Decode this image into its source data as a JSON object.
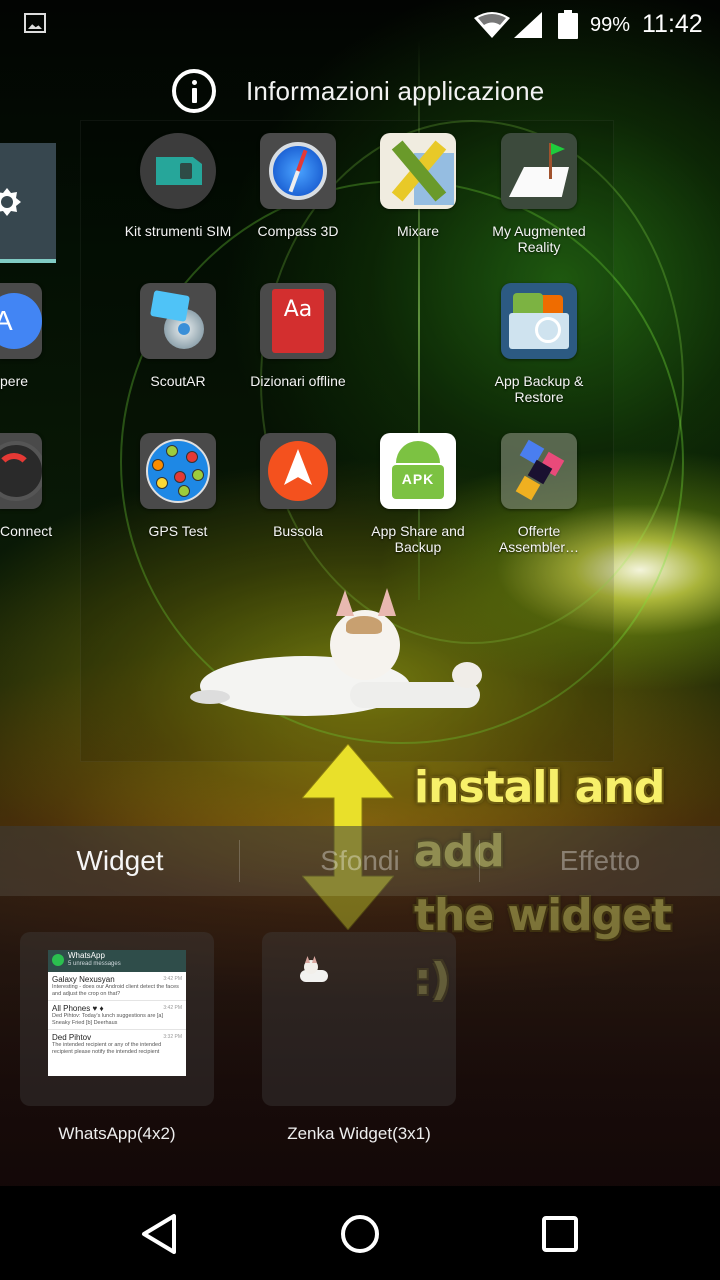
{
  "status_bar": {
    "notification_icon": "image-icon",
    "wifi_icon": "wifi-icon",
    "signal_icon": "cell-signal-icon",
    "battery_icon": "battery-icon",
    "battery_percent": "99%",
    "time": "11:42"
  },
  "drop_target": {
    "icon": "info-icon",
    "label": "Informazioni applicazione"
  },
  "apps": [
    {
      "label": "Kit strumenti SIM",
      "icon": "sim-card-icon"
    },
    {
      "label": "Compass 3D",
      "icon": "compass-icon"
    },
    {
      "label": "Mixare",
      "icon": "mixare-icon"
    },
    {
      "label": "My Augmented Reality",
      "icon": "ar-board-flag-icon"
    },
    {
      "label": "ScoutAR",
      "icon": "scoutar-icon"
    },
    {
      "label": "Dizionari offline",
      "icon": "dictionary-icon",
      "icon_text": "Aa"
    },
    {
      "label": "App Backup & Restore",
      "icon": "app-backup-icon"
    },
    {
      "label": "GPS Test",
      "icon": "gps-radar-icon"
    },
    {
      "label": "Bussola",
      "icon": "compass-arrow-icon"
    },
    {
      "label": "App Share and Backup",
      "icon": "apk-android-icon",
      "icon_text": "APK"
    },
    {
      "label": "Offerte Assembler…",
      "icon": "offerte-assembler-icon"
    }
  ],
  "left_page_apps": [
    {
      "label": "pere",
      "icon": "blue-a-icon",
      "icon_text": "A"
    },
    {
      "label": "Connect",
      "icon": "wifi-connect-icon"
    }
  ],
  "annotation": {
    "line1": "install and add",
    "line2": "the widget :)"
  },
  "picker": {
    "tabs": [
      {
        "label": "Widget",
        "active": true
      },
      {
        "label": "Sfondi",
        "active": false
      },
      {
        "label": "Effetto",
        "active": false
      }
    ],
    "widgets": [
      {
        "label": "WhatsApp(4x2)"
      },
      {
        "label": "Zenka Widget(3x1)"
      }
    ],
    "whatsapp_preview": {
      "title": "WhatsApp",
      "subtitle": "5 unread messages",
      "items": [
        {
          "name": "Galaxy Nexusyan",
          "time": "3:42 PM",
          "message": "Interesting - does our Android client detect the faces and adjust the crop on that?"
        },
        {
          "name": "All Phones ♥ ♦",
          "time": "3:42 PM",
          "message": "Ded Pihtov: Today's lunch suggestions are [a] Sneaky Fried [b] Deerhaus"
        },
        {
          "name": "Ded Pihtov",
          "time": "3:32 PM",
          "message": "The intended recipient or any of the intended recipient please notify the intended recipient"
        }
      ]
    }
  },
  "nav": {
    "back": "back-icon",
    "home": "home-icon",
    "recents": "recents-icon"
  },
  "colors": {
    "left_page_bg": "#37474f",
    "left_page_indicator": "#80cbc4",
    "annotation_yellow": "#f7f06a",
    "arrow_yellow": "#e9e02a"
  }
}
